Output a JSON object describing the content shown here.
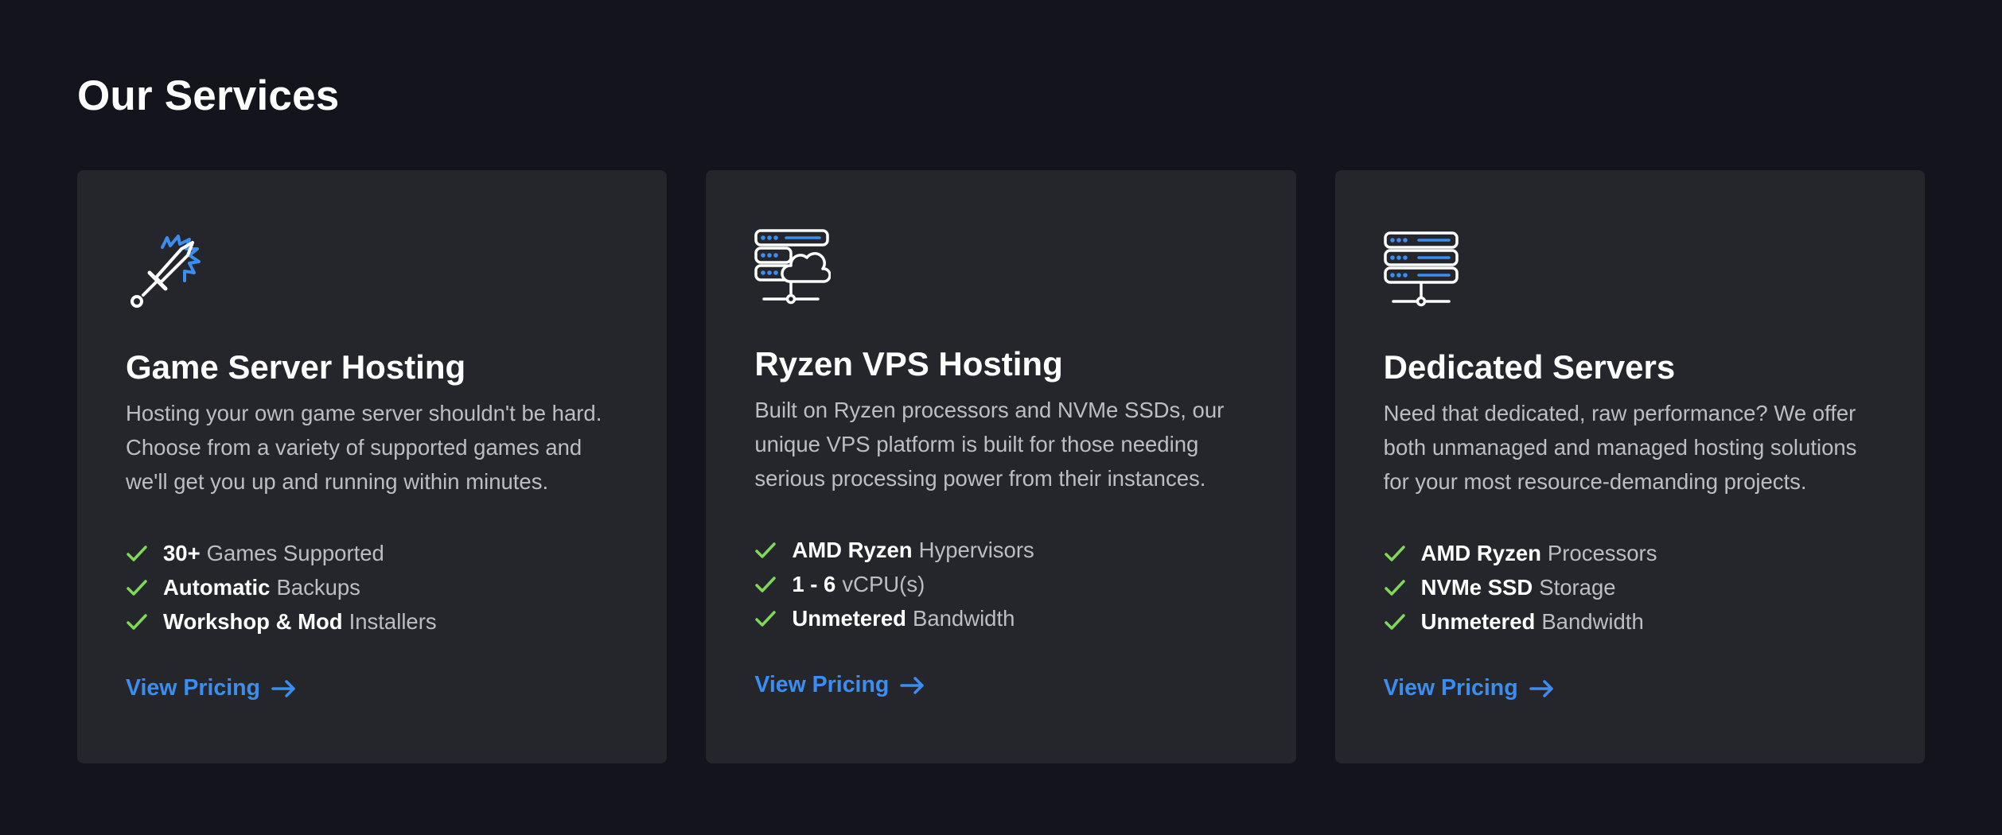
{
  "section": {
    "title": "Our Services"
  },
  "colors": {
    "background": "#14151c",
    "card": "#25262c",
    "accent": "#3b8df0",
    "check": "#7ed957"
  },
  "cards": [
    {
      "icon": "sword-icon",
      "title": "Game Server Hosting",
      "description": "Hosting your own game server shouldn't be hard. Choose from a variety of supported games and we'll get you up and running within minutes.",
      "features": [
        {
          "strong": "30+",
          "rest": "Games Supported"
        },
        {
          "strong": "Automatic",
          "rest": "Backups"
        },
        {
          "strong": "Workshop & Mod",
          "rest": "Installers"
        }
      ],
      "link": "View Pricing"
    },
    {
      "icon": "cloud-server-icon",
      "title": "Ryzen VPS Hosting",
      "description": "Built on Ryzen processors and NVMe SSDs, our unique VPS platform is built for those needing serious processing power from their instances.",
      "features": [
        {
          "strong": "AMD Ryzen",
          "rest": "Hypervisors"
        },
        {
          "strong": "1 - 6",
          "rest": "vCPU(s)"
        },
        {
          "strong": "Unmetered",
          "rest": "Bandwidth"
        }
      ],
      "link": "View Pricing"
    },
    {
      "icon": "server-rack-icon",
      "title": "Dedicated Servers",
      "description": "Need that dedicated, raw performance? We offer both unmanaged and managed hosting solutions for your most resource-demanding projects.",
      "features": [
        {
          "strong": "AMD Ryzen",
          "rest": "Processors"
        },
        {
          "strong": "NVMe SSD",
          "rest": "Storage"
        },
        {
          "strong": "Unmetered",
          "rest": "Bandwidth"
        }
      ],
      "link": "View Pricing"
    }
  ]
}
